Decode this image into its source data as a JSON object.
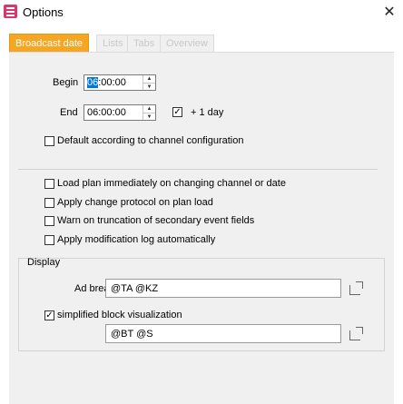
{
  "window": {
    "title": "Options",
    "close_glyph": "✕"
  },
  "tabs": [
    {
      "label": "Broadcast date",
      "active": true
    },
    {
      "label": "Lists",
      "active": false
    },
    {
      "label": "Tabs",
      "active": false
    },
    {
      "label": "Overview",
      "active": false
    }
  ],
  "time": {
    "begin_label": "Begin",
    "begin_value_selected": "06",
    "begin_value_rest": ":00:00",
    "end_label": "End",
    "end_value": "06:00:00",
    "plus_one_day_label": "+ 1 day",
    "plus_one_day_checked": true
  },
  "options": {
    "default_channel_label": "Default according to channel configuration",
    "load_plan_label": "Load plan immediately on changing channel or date",
    "apply_change_protocol_label": "Apply change protocol on plan load",
    "warn_truncation_label": "Warn on truncation of secondary event fields",
    "apply_modification_log_label": "Apply modification log automatically"
  },
  "display": {
    "group_title": "Display",
    "ad_break_label": "Ad break",
    "ad_break_value": "@TA @KZ",
    "simplified_label": "simplified block visualization",
    "simplified_checked": true,
    "simplified_value": "@BT @S"
  },
  "colors": {
    "accent": "#f5a623",
    "app_icon": "#d9366b",
    "selection": "#0078d7"
  },
  "icons": {
    "app": "options-menu-icon",
    "open": "open-external-icon",
    "close": "close-icon"
  }
}
